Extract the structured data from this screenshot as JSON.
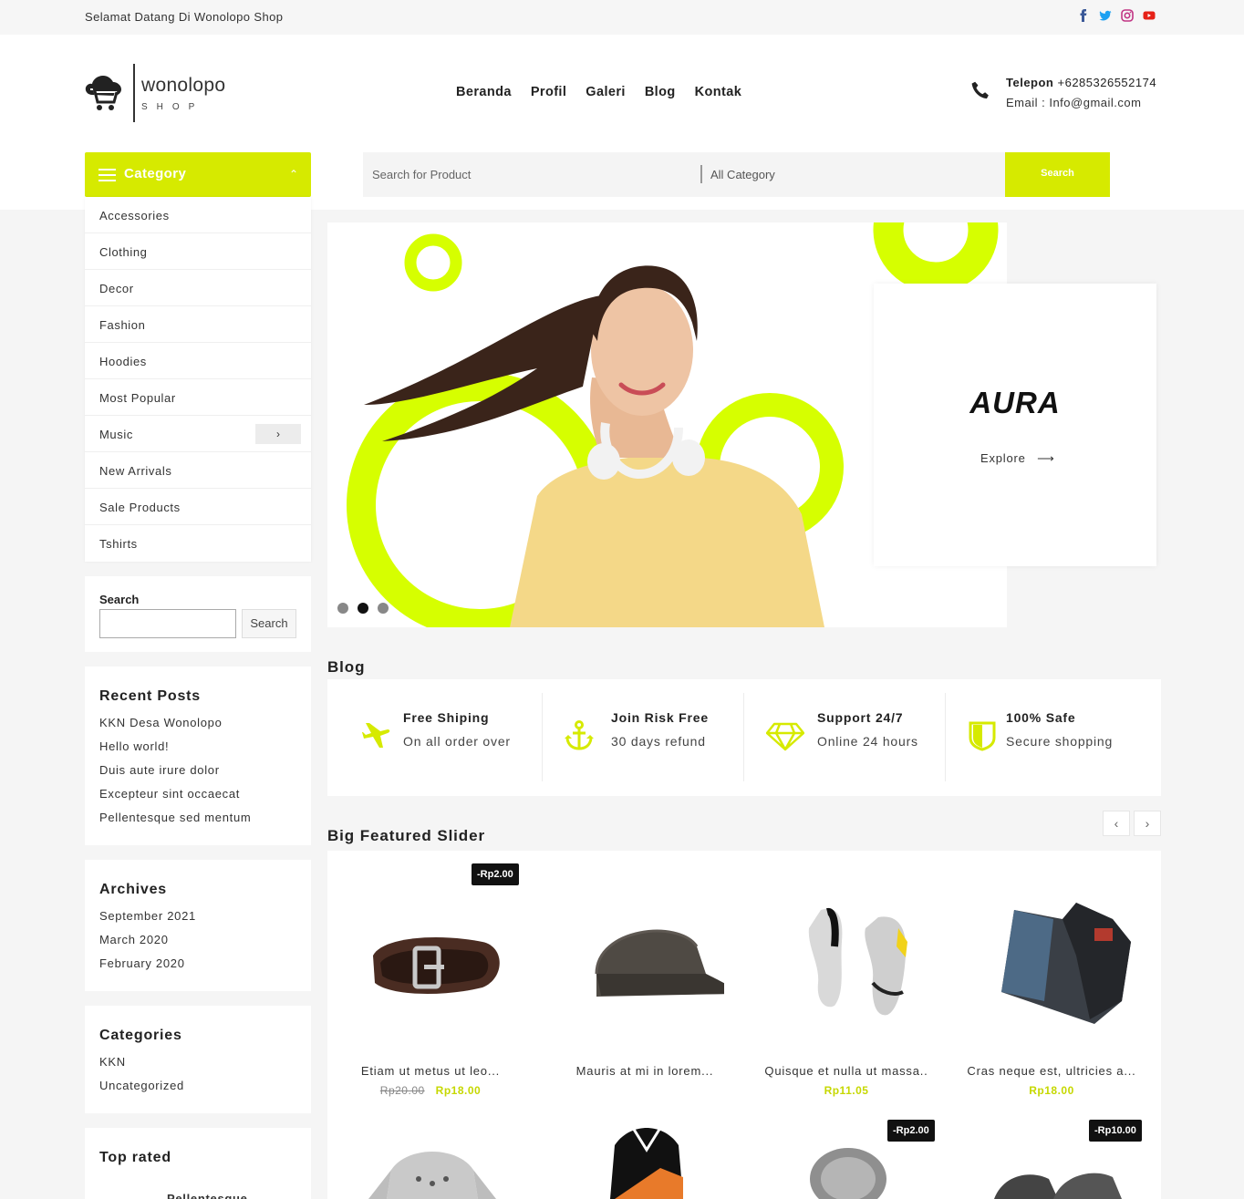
{
  "topbar": {
    "welcome": "Selamat Datang Di Wonolopo Shop",
    "social_icons": [
      "facebook-icon",
      "twitter-icon",
      "instagram-icon",
      "youtube-icon"
    ]
  },
  "brand": {
    "name": "wonolopo",
    "sub": "SHOP",
    "accent": "#d6ea00"
  },
  "nav": [
    "Beranda",
    "Profil",
    "Galeri",
    "Blog",
    "Kontak"
  ],
  "contact": {
    "phone_label": "Telepon",
    "phone": "+6285326552174",
    "email": "Email : Info@gmail.com"
  },
  "category_menu": {
    "title": "Category",
    "items": [
      "Accessories",
      "Clothing",
      "Decor",
      "Fashion",
      "Hoodies",
      "Most Popular",
      "Music",
      "New Arrivals",
      "Sale Products",
      "Tshirts"
    ],
    "expand_label": "›"
  },
  "search": {
    "placeholder": "Search for Product",
    "category": "All Category",
    "button": "Search"
  },
  "sidebar": {
    "search": {
      "label": "Search",
      "button": "Search"
    },
    "recent_posts": {
      "title": "Recent Posts",
      "items": [
        "KKN Desa Wonolopo",
        "Hello world!",
        "Duis aute irure dolor",
        "Excepteur sint occaecat",
        "Pellentesque sed mentum"
      ]
    },
    "archives": {
      "title": "Archives",
      "items": [
        "September 2021",
        "March 2020",
        "February 2020"
      ]
    },
    "categories": {
      "title": "Categories",
      "items": [
        "KKN",
        "Uncategorized"
      ]
    },
    "top_rated": {
      "title": "Top rated",
      "first_item": "Pellentesque"
    }
  },
  "hero": {
    "brand": "AURA",
    "cta": "Explore",
    "slides": 3,
    "active_slide": 2
  },
  "blog": {
    "title": "Blog",
    "features": [
      {
        "icon": "plane-icon",
        "title": "Free Shiping",
        "sub": "On all order over"
      },
      {
        "icon": "anchor-icon",
        "title": "Join Risk Free",
        "sub": "30 days refund"
      },
      {
        "icon": "diamond-icon",
        "title": "Support 24/7",
        "sub": "Online 24 hours"
      },
      {
        "icon": "shield-icon",
        "title": "100% Safe",
        "sub": "Secure shopping"
      }
    ]
  },
  "featured": {
    "title": "Big Featured Slider",
    "prev": "‹",
    "next": "›",
    "products": [
      {
        "name": "Etiam ut metus ut leo...",
        "old_price": "Rp20.00",
        "price": "Rp18.00",
        "badge": "-Rp2.00",
        "image": "belt"
      },
      {
        "name": "Mauris at mi in lorem...",
        "old_price": "",
        "price": "",
        "badge": "",
        "image": "cap"
      },
      {
        "name": "Quisque et nulla ut massa..",
        "old_price": "",
        "price": "Rp11.05",
        "badge": "",
        "image": "sneakers"
      },
      {
        "name": "Cras neque est, ultricies a...",
        "old_price": "",
        "price": "Rp18.00",
        "badge": "",
        "image": "jeans"
      }
    ],
    "row2_badges": [
      "-Rp2.00",
      "-Rp10.00"
    ]
  }
}
